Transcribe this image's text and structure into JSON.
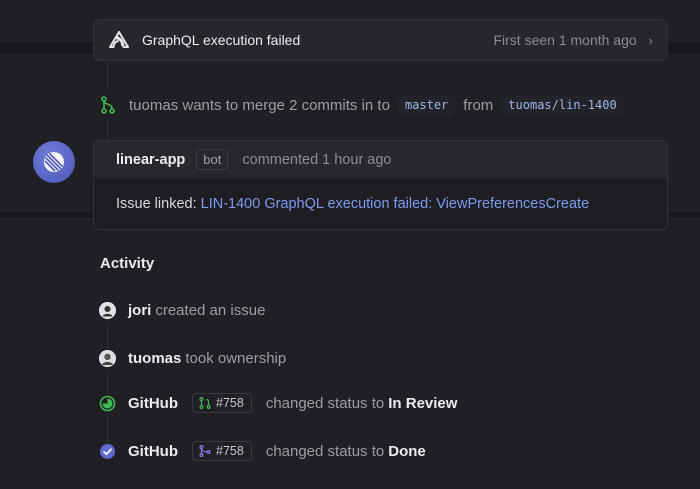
{
  "sentry": {
    "title": "GraphQL execution failed",
    "first_seen": "First seen 1 month ago",
    "icon": "sentry-icon"
  },
  "merge": {
    "text": "tuomas wants to merge 2 commits in to",
    "base_branch": "master",
    "from_label": "from",
    "head_branch": "tuomas/lin-1400",
    "icon": "git-merge-icon"
  },
  "comment": {
    "user": "linear-app",
    "badge": "bot",
    "when": "commented 1 hour ago",
    "body_prefix": "Issue linked:",
    "link_text": "LIN-1400 GraphQL execution failed: ViewPreferencesCreate"
  },
  "activity": {
    "title": "Activity",
    "items": [
      {
        "who": "jori",
        "text": "created an issue",
        "icon": "user-avatar-icon"
      },
      {
        "who": "tuomas",
        "text": "took ownership",
        "icon": "user-avatar-icon"
      },
      {
        "who": "GitHub",
        "pr": "#758",
        "text": "changed status to",
        "status": "In Review",
        "icon": "in-review-status-icon"
      },
      {
        "who": "GitHub",
        "pr": "#758",
        "text": "changed status to",
        "status": "Done",
        "icon": "done-status-icon"
      }
    ]
  },
  "colors": {
    "accent_blue": "#7d9bf0",
    "merge_green": "#3fb950",
    "review_green": "#3fb950",
    "done_blue": "#5e6ad2"
  }
}
